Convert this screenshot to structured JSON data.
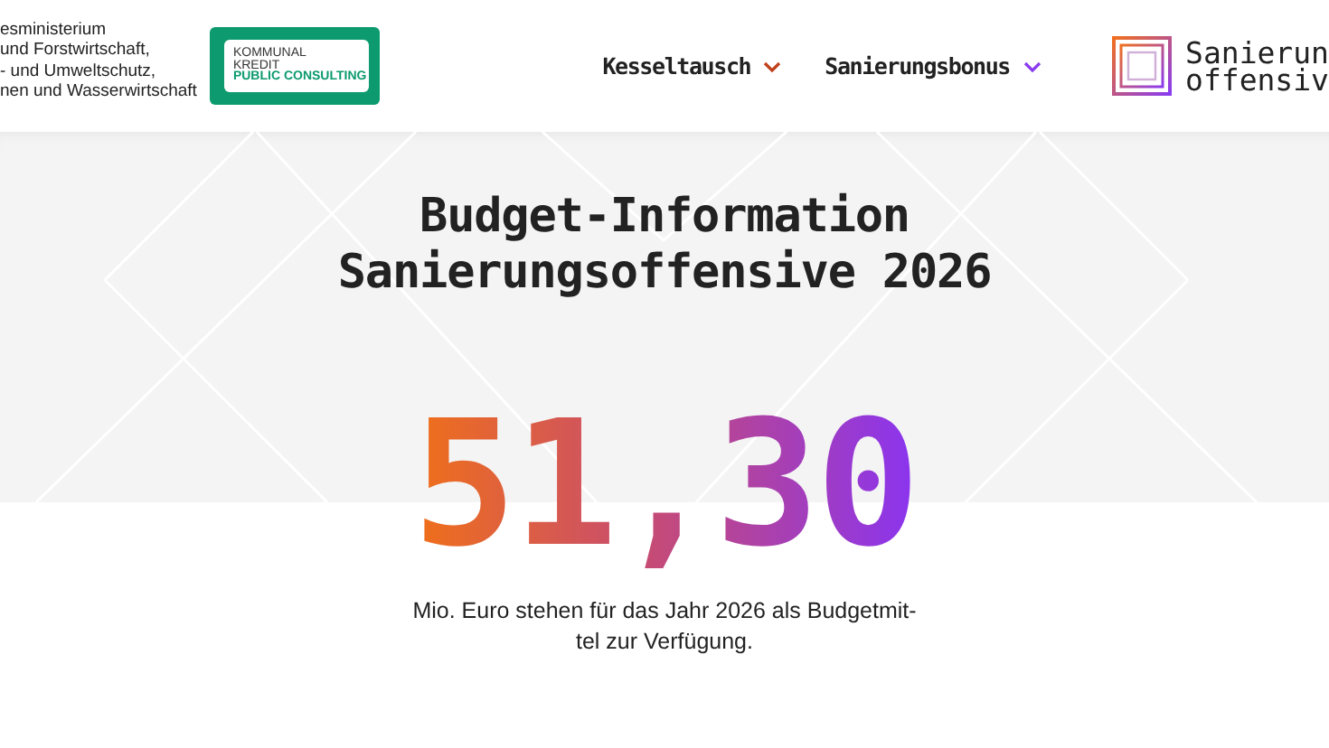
{
  "header": {
    "ministry_lines": [
      "esministerium",
      "und Forstwirtschaft,",
      "- und Umweltschutz,",
      "nen und Wasserwirtschaft"
    ],
    "partner_logo": {
      "lines": [
        "KOMMUNAL",
        "KREDIT",
        "PUBLIC CONSULTING"
      ]
    },
    "nav": [
      {
        "label": "Kesseltausch",
        "color": "#c0401a"
      },
      {
        "label": "Sanierungsbonus",
        "color": "#8a3cf0"
      }
    ],
    "brand": {
      "lines": [
        "Sanierun",
        "offensiv"
      ]
    }
  },
  "hero": {
    "title_lines": [
      "Budget-Information",
      "Sanierungsoffensive 2026"
    ],
    "amount": "51,30",
    "caption": "Mio. Euro stehen für das Jahr 2026 als Budgetmit-tel zur Verfügung."
  }
}
